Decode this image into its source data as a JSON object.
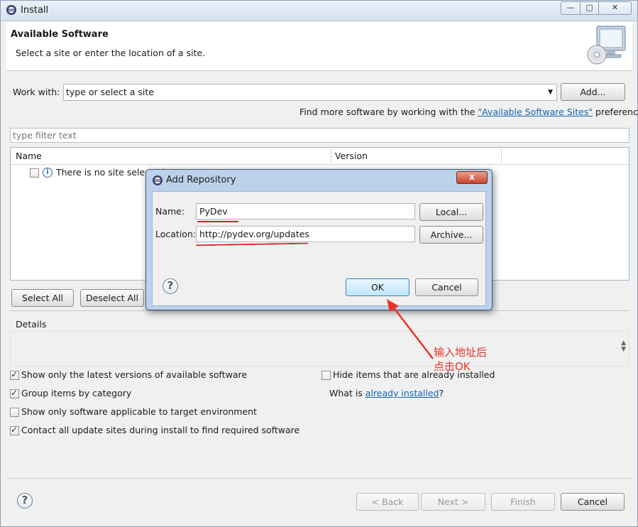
{
  "window": {
    "title": "Install",
    "controls": [
      "—",
      "▢",
      "✕"
    ]
  },
  "header": {
    "title": "Available Software",
    "subtitle": "Select a site or enter the location of a site."
  },
  "work_with": {
    "label": "Work with:",
    "value": "type or select a site",
    "add_button": "Add...",
    "hint_prefix": "Find more software by working with the ",
    "hint_link": "\"Available Software Sites\"",
    "hint_suffix": " preferences."
  },
  "filter": {
    "placeholder": "type filter text"
  },
  "table": {
    "columns": [
      "Name",
      "Version"
    ],
    "rows": [
      {
        "name": "There is no site selected.",
        "checked": false
      }
    ]
  },
  "select_all": "Select All",
  "deselect_all": "Deselect All",
  "details": {
    "label": "Details"
  },
  "options": [
    {
      "label": "Show only the latest versions of available software",
      "checked": true
    },
    {
      "label": "Group items by category",
      "checked": true
    },
    {
      "label": "Show only software applicable to target environment",
      "checked": false
    },
    {
      "label": "Contact all update sites during install to find required software",
      "checked": true
    },
    {
      "label": "Hide items that are already installed",
      "checked": false
    }
  ],
  "installed_text": {
    "prefix": "What is ",
    "link": "already installed",
    "suffix": "?"
  },
  "footer": {
    "back": "< Back",
    "next": "Next >",
    "finish": "Finish",
    "cancel": "Cancel"
  },
  "dialog": {
    "title": "Add Repository",
    "close": "x",
    "name_label": "Name:",
    "name_value": "PyDev",
    "local_button": "Local...",
    "location_label": "Location:",
    "location_value": "http://pydev.org/updates",
    "archive_button": "Archive...",
    "ok_button": "OK",
    "cancel_button": "Cancel"
  },
  "annotation": {
    "line1": "输入地址后",
    "line2": "点击OK",
    "color": "#e8332a"
  }
}
